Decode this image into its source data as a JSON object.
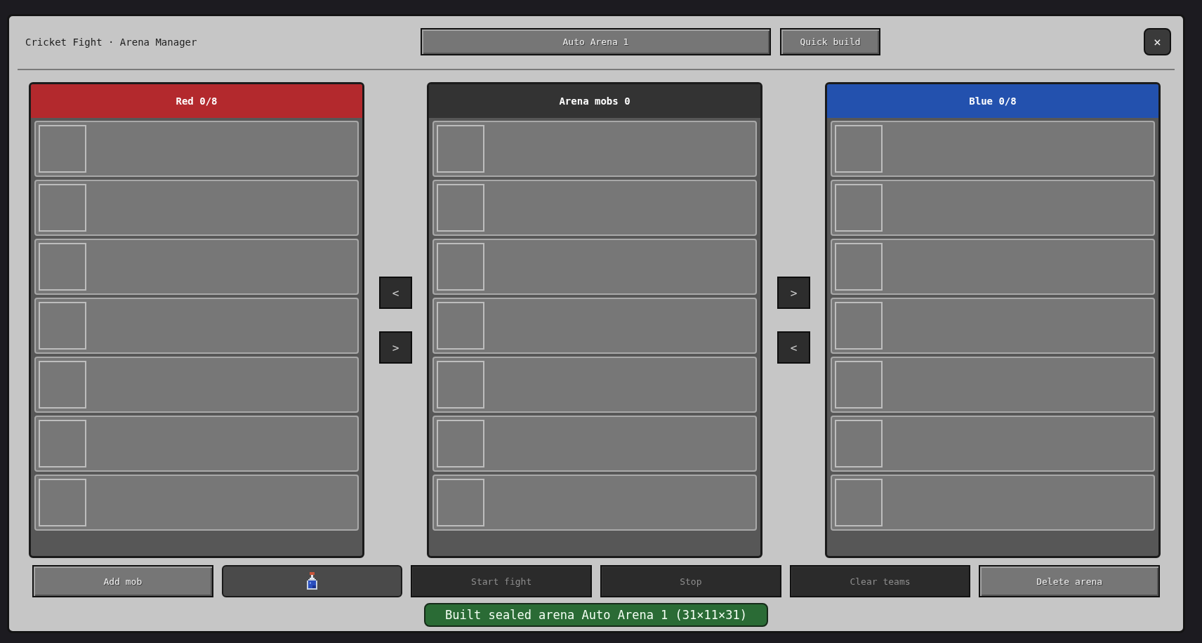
{
  "window": {
    "title": "Cricket Fight · Arena Manager",
    "close": "×"
  },
  "toolbar": {
    "arena_selector": "Auto Arena 1",
    "quick_build": "Quick build"
  },
  "panels": [
    {
      "kind": "team",
      "title": "Red 0/8",
      "color": "#b3292d",
      "slots": [
        {
          "empty": true
        },
        {
          "empty": true
        },
        {
          "empty": true
        },
        {
          "empty": true
        },
        {
          "empty": true
        },
        {
          "empty": true
        },
        {
          "empty": true
        }
      ]
    },
    {
      "kind": "arrows",
      "buttons": [
        {
          "label": "<"
        },
        {
          "label": ">"
        }
      ]
    },
    {
      "kind": "team",
      "title": "Arena mobs 0",
      "color": "#333333",
      "slots": [
        {
          "empty": true
        },
        {
          "empty": true
        },
        {
          "empty": true
        },
        {
          "empty": true
        },
        {
          "empty": true
        },
        {
          "empty": true
        },
        {
          "empty": true
        }
      ]
    },
    {
      "kind": "arrows",
      "buttons": [
        {
          "label": ">"
        },
        {
          "label": "<"
        }
      ]
    },
    {
      "kind": "team",
      "title": "Blue 0/8",
      "color": "#2351ae",
      "slots": [
        {
          "empty": true
        },
        {
          "empty": true
        },
        {
          "empty": true
        },
        {
          "empty": true
        },
        {
          "empty": true
        },
        {
          "empty": true
        },
        {
          "empty": true
        }
      ]
    }
  ],
  "actions": [
    {
      "kind": "text",
      "label": "Add mob",
      "disabled": false
    },
    {
      "kind": "icon",
      "disabled": false
    },
    {
      "kind": "text",
      "label": "Start fight",
      "disabled": true
    },
    {
      "kind": "text",
      "label": "Stop",
      "disabled": true
    },
    {
      "kind": "text",
      "label": "Clear teams",
      "disabled": true
    },
    {
      "kind": "text",
      "label": "Delete arena",
      "disabled": false
    }
  ],
  "status": "Built sealed arena Auto Arena 1 (31×11×31)"
}
